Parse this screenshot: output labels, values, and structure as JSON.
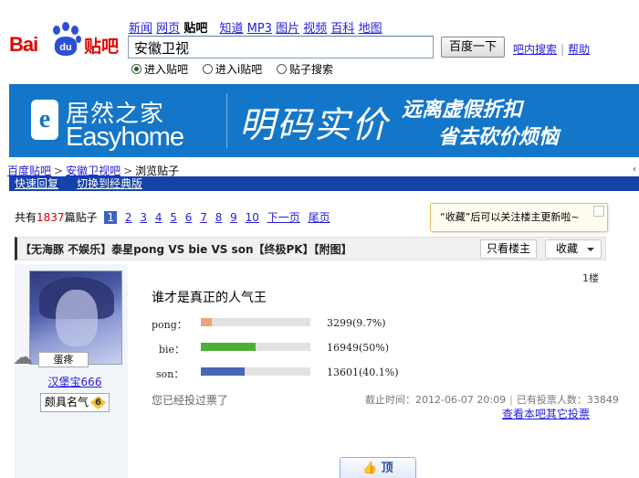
{
  "header": {
    "nav": [
      {
        "label": "新闻",
        "current": false
      },
      {
        "label": "网页",
        "current": false
      },
      {
        "label": "贴吧",
        "current": true
      },
      {
        "label": "知道",
        "current": false
      },
      {
        "label": "MP3",
        "current": false
      },
      {
        "label": "图片",
        "current": false
      },
      {
        "label": "视频",
        "current": false
      },
      {
        "label": "百科",
        "current": false
      },
      {
        "label": "地图",
        "current": false
      }
    ],
    "logo_text": "Bai",
    "logo_du": "du",
    "logo_tieba": "贴吧",
    "search_value": "安徽卫视",
    "search_button": "百度一下",
    "inbar_search": "吧内搜索",
    "help": "帮助",
    "radio_options": [
      "进入贴吧",
      "进入i贴吧",
      "贴子搜索"
    ]
  },
  "banner": {
    "brand_cn": "居然之家",
    "brand_en": "Easyhome",
    "logo_letter": "e",
    "slogan": "明码实价",
    "sub1": "远离虚假折扣",
    "sub2": "省去砍价烦恼",
    "background": "#1476c9"
  },
  "breadcrumb": {
    "items": [
      "百度贴吧",
      "安徽卫视吧",
      "浏览贴子"
    ],
    "sep": ">",
    "right_char": "‹"
  },
  "quickbar": {
    "links": [
      "快速回复",
      "切换到经典版"
    ],
    "background": "#1442a8"
  },
  "pager": {
    "prefix": "共有",
    "count": "1837",
    "suffix": "篇贴子",
    "pages": [
      "1",
      "2",
      "3",
      "4",
      "5",
      "6",
      "7",
      "8",
      "9",
      "10"
    ],
    "current": "1",
    "next": "下一页",
    "last": "尾页"
  },
  "tooltip": "“收藏”后可以关注楼主更新啦~",
  "thread": {
    "title": "【无海豚 不娱乐】泰星pong VS bie VS son【终极PK】【附图】",
    "only_host": "只看楼主",
    "favorite": "收藏"
  },
  "user": {
    "badge": "蛋疼",
    "name": "汉堡宝666",
    "title": "颇具名气",
    "level": "6"
  },
  "post": {
    "floor": "1楼",
    "vote_title": "谁才是真正的人气王",
    "options": [
      {
        "name": "pong：",
        "votes": "3299(9.7%)",
        "fraction": 0.097,
        "color": "#e8a678"
      },
      {
        "name": "bie：",
        "votes": "16949(50%)",
        "fraction": 0.5,
        "color": "#4caf3c"
      },
      {
        "name": "son：",
        "votes": "13601(40.1%)",
        "fraction": 0.401,
        "color": "#4a67b5"
      }
    ],
    "voted_msg": "您已经投过票了",
    "deadline": "截止时间：2012-06-07 20:09",
    "voters": "已有投票人数：33849",
    "other_votes": "查看本吧其它投票",
    "ding": "顶"
  }
}
